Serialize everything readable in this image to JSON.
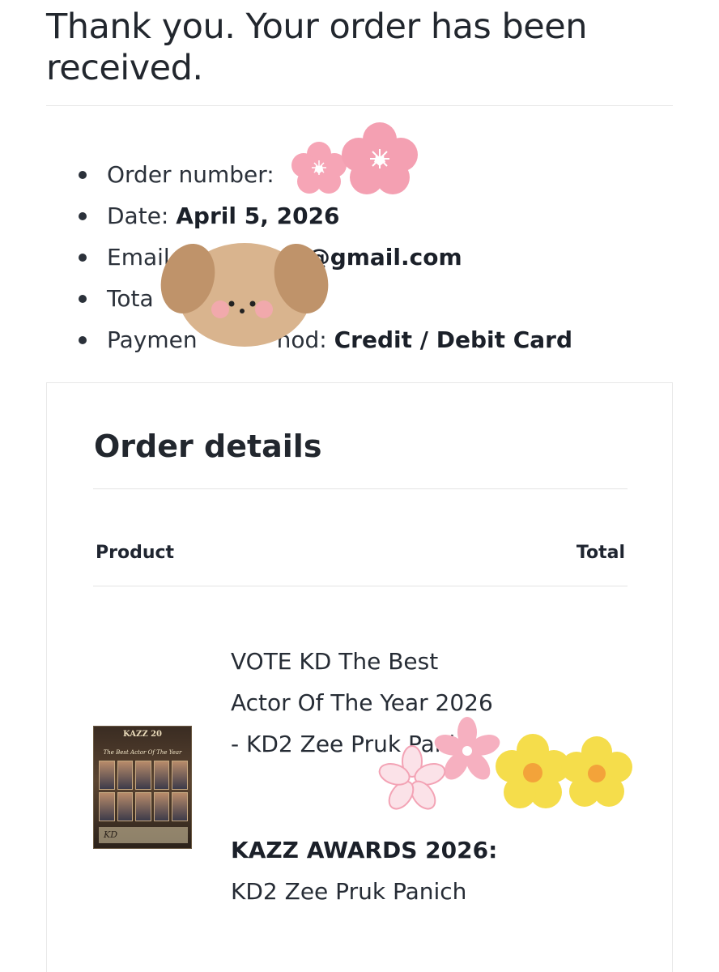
{
  "header": {
    "thank_you": "Thank you. Your order has been received."
  },
  "overview": {
    "order_number_label": "Order number:",
    "date_label": "Date:",
    "date_value": "April 5, 2026",
    "email_label": "Email",
    "email_value": "@gmail.com",
    "total_label": "Tota",
    "payment_label": "Paymen",
    "payment_label_tail": "hod:",
    "payment_value": "Credit / Debit Card"
  },
  "order_details": {
    "title": "Order details",
    "col_product": "Product",
    "col_total": "Total",
    "item": {
      "name": "VOTE KD The Best Actor Of The Year 2026 - KD2 Zee Pruk Panich",
      "meta_key": "KAZZ AWARDS 2026:",
      "meta_value": "KD2 Zee Pruk Panich",
      "thumbnail": {
        "logo": "KAZZ 20",
        "caption": "The Best Actor Of The Year",
        "footer": "KD"
      }
    }
  },
  "colors": {
    "text": "#22272e",
    "divider": "#e4e4e4",
    "sticker_pink": "#f6a5b6",
    "sticker_brown": "#c9a27a",
    "sticker_yellow": "#f5dd4b"
  }
}
